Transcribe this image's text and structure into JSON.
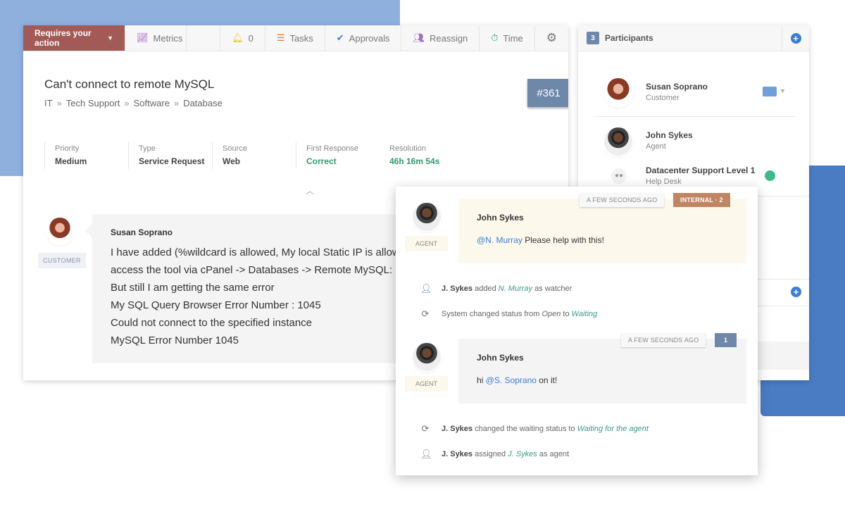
{
  "toolbar": {
    "action": "Requires your action",
    "metrics": "Metrics",
    "notifications": "0",
    "tasks": "Tasks",
    "approvals": "Approvals",
    "reassign": "Reassign",
    "time": "Time"
  },
  "ticket": {
    "title": "Can't connect to remote MySQL",
    "breadcrumb": [
      "IT",
      "Tech Support",
      "Software",
      "Database"
    ],
    "id": "#361",
    "props": [
      {
        "label": "Priority",
        "value": "Medium"
      },
      {
        "label": "Type",
        "value": "Service Request"
      },
      {
        "label": "Source",
        "value": "Web"
      },
      {
        "label": "First Response",
        "value": "Correct"
      },
      {
        "label": "Resolution",
        "value": "46h 16m 54s"
      }
    ]
  },
  "message": {
    "author": "Susan Soprano",
    "role": "CUSTOMER",
    "lines": [
      "I have added (%wildcard is allowed, My local Static IP is allowed",
      "access the tool via cPanel -> Databases -> Remote MySQL: Ren",
      "But still I am getting the same error",
      "My SQL Query Browser Error Number : 1045",
      "Could not connect to the specified instance",
      "MySQL Error Number 1045"
    ]
  },
  "participants": {
    "count": "3",
    "title": "Participants",
    "items": [
      {
        "name": "Susan Soprano",
        "role": "Customer"
      },
      {
        "name": "John Sykes",
        "role": "Agent"
      },
      {
        "name": "Datacenter Support Level 1",
        "role": "Help Desk"
      }
    ]
  },
  "timeline": {
    "msg1": {
      "author": "John Sykes",
      "role": "AGENT",
      "time": "A FEW SECONDS AGO",
      "badge": "INTERNAL · 2",
      "mention": "@N. Murray",
      "text": " Please help with this!"
    },
    "ev1": {
      "actor": "J. Sykes",
      "a": " added ",
      "target": "N. Murray",
      "b": " as watcher"
    },
    "ev2": {
      "a": "System changed status from ",
      "from": "Open",
      "b": " to ",
      "to": "Waiting"
    },
    "msg2": {
      "author": "John Sykes",
      "role": "AGENT",
      "time": "A FEW SECONDS AGO",
      "badge": "1",
      "pre": "hi ",
      "mention": "@S. Soprano",
      "text": " on it!"
    },
    "ev3": {
      "actor": "J. Sykes",
      "a": " changed the waiting status to ",
      "target": "Waiting for the agent"
    },
    "ev4": {
      "actor": "J. Sykes",
      "a": " assigned ",
      "target": "J. Sykes",
      "b": " as agent"
    }
  },
  "colors": {
    "action": "#a35a57",
    "accent": "#3d7dd0",
    "badge": "#6f87a8",
    "internal": "#c08562",
    "success": "#2e9a6d"
  }
}
